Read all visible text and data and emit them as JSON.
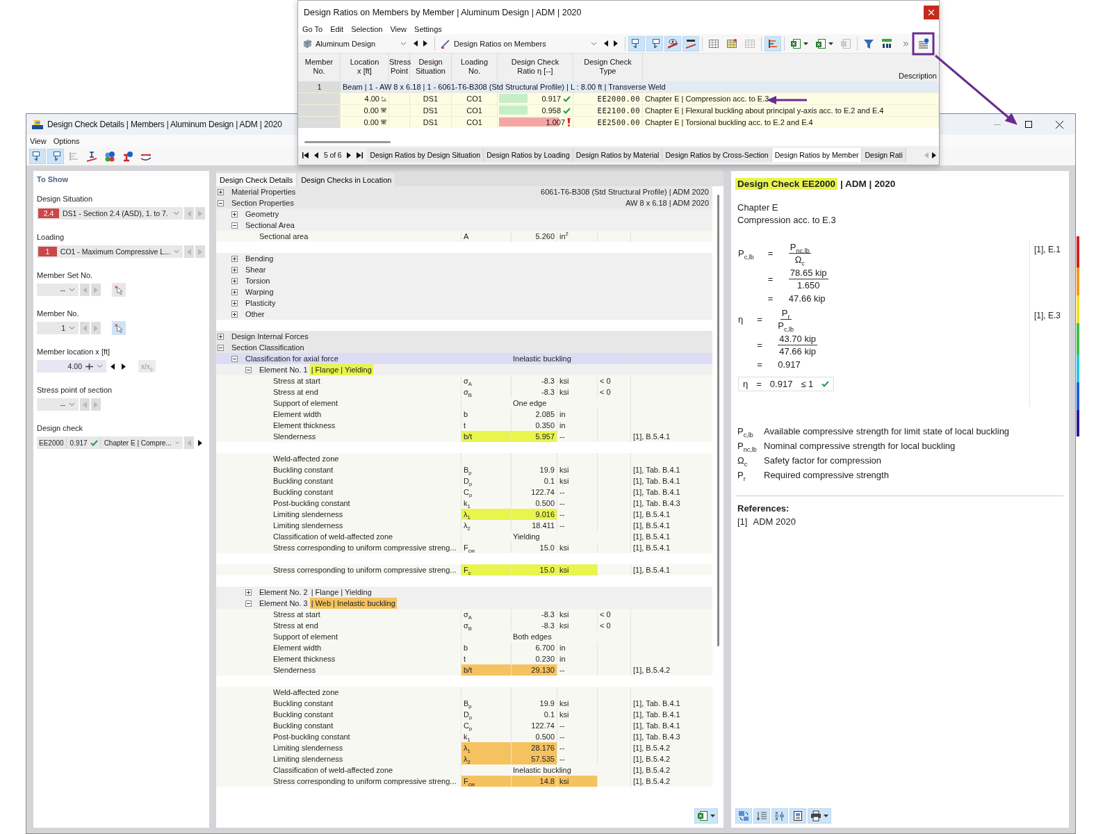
{
  "ratios_window": {
    "title": "Design Ratios on Members by Member | Aluminum Design | ADM | 2020",
    "menu": [
      "Go To",
      "Edit",
      "Selection",
      "View",
      "Settings"
    ],
    "module": "Aluminum Design",
    "result_type": "Design Ratios on Members",
    "tool_groups": [
      [
        {
          "kind": "select-next",
          "on": true
        },
        {
          "kind": "select-prev",
          "on": true
        },
        {
          "kind": "visibility",
          "on": true
        },
        {
          "kind": "decimals",
          "on": true
        }
      ],
      [
        {
          "kind": "table",
          "on": false
        },
        {
          "kind": "table-highlight",
          "on": false
        },
        {
          "kind": "table-disabled",
          "on": false
        }
      ],
      [
        {
          "kind": "bars",
          "on": true
        }
      ],
      [
        {
          "kind": "excel-export",
          "on": false,
          "dropdown": true
        },
        {
          "kind": "excel-import",
          "on": false,
          "dropdown": true
        },
        {
          "kind": "export-disabled",
          "on": false
        }
      ],
      [
        {
          "kind": "filter",
          "on": false
        },
        {
          "kind": "decimals-format",
          "on": false
        }
      ]
    ],
    "info_tool": {
      "kind": "info-list",
      "on": false
    },
    "columns": [
      "Member\nNo.",
      "Location\nx [ft]",
      "Stress\nPoint",
      "Design\nSituation",
      "Loading\nNo.",
      "Design Check\nRatio η [--]",
      "Design Check\nType",
      "Description"
    ],
    "group": {
      "member": "1",
      "text": "Beam | 1 - AW 8 x 6.18 | 1 - 6061-T6-B308 (Std Structural Profile) | L : 8.00 ft | Transverse Weld"
    },
    "rows": [
      {
        "location": "4.00",
        "midpoint": true,
        "situation": "DS1",
        "loading": "CO1",
        "ratio": "0.917",
        "ok": true,
        "type": "EE2000.00",
        "description": "Chapter E | Compression acc. to E.3"
      },
      {
        "location": "0.00",
        "midpoint": false,
        "situation": "DS1",
        "loading": "CO1",
        "ratio": "0.958",
        "ok": true,
        "type": "EE2100.00",
        "description": "Chapter E | Flexural buckling about principal y-axis acc. to E.2 and E.4"
      },
      {
        "location": "0.00",
        "midpoint": false,
        "situation": "DS1",
        "loading": "CO1",
        "ratio": "1.007",
        "ok": false,
        "type": "EE2500.00",
        "description": "Chapter E | Torsional buckling acc. to E.2 and E.4"
      }
    ],
    "pager": "5 of 6",
    "tabs": [
      {
        "label": "Design Ratios by Design Situation",
        "selected": false
      },
      {
        "label": "Design Ratios by Loading",
        "selected": false
      },
      {
        "label": "Design Ratios by Material",
        "selected": false
      },
      {
        "label": "Design Ratios by Cross-Section",
        "selected": false
      },
      {
        "label": "Design Ratios by Member",
        "selected": true
      },
      {
        "label": "Design Rati",
        "selected": false
      }
    ]
  },
  "details_window": {
    "title": "Design Check Details | Members | Aluminum Design | ADM | 2020",
    "menu": [
      "View",
      "Options"
    ],
    "tool_groups": [
      [
        {
          "kind": "select-next",
          "on": true
        },
        {
          "kind": "select-prev",
          "on": true
        },
        {
          "kind": "bars-disabled",
          "on": false
        },
        {
          "kind": "member-section",
          "on": false
        },
        {
          "kind": "color-info",
          "on": false
        },
        {
          "kind": "section-info",
          "on": false
        },
        {
          "kind": "deflection",
          "on": false
        }
      ]
    ],
    "filter": {
      "heading": "To Show",
      "fields": [
        {
          "kind": "combo",
          "label": "Design Situation",
          "badge": "2.4",
          "value": "DS1 - Section 2.4 (ASD), 1. to 7.",
          "prev_enabled": false,
          "next_enabled": false
        },
        {
          "kind": "combo",
          "label": "Loading",
          "badge": "1",
          "value": "CO1 - Maximum Compressive L...",
          "prev_enabled": false,
          "next_enabled": false
        },
        {
          "kind": "number",
          "label": "Member Set No.",
          "value": "--",
          "prev_enabled": false,
          "next_enabled": false,
          "pick_active": false
        },
        {
          "kind": "number",
          "label": "Member No.",
          "value": "1",
          "prev_enabled": false,
          "next_enabled": false,
          "pick_active": true
        },
        {
          "kind": "location",
          "label": "Member location x [ft]",
          "value": "4.00",
          "prev_enabled": true,
          "next_enabled": true,
          "extra": "x/x$_{0}$",
          "extra_disabled": true
        },
        {
          "kind": "number",
          "label": "Stress point of section",
          "value": "--",
          "prev_enabled": false,
          "next_enabled": false
        },
        {
          "kind": "check",
          "label": "Design check",
          "code": "EE2000",
          "ratio": "0.917",
          "ok": true,
          "value": "Chapter E | Compre...",
          "prev_enabled": false,
          "next_enabled": true
        }
      ]
    },
    "tabs": [
      {
        "label": "Design Check Details",
        "selected": true
      },
      {
        "label": "Design Checks in Location",
        "selected": false
      }
    ],
    "tree": [
      {
        "label": "Material Properties",
        "info": "6061-T6-B308 (Std Structural Profile) | ADM 2020",
        "expanded": false,
        "selected": false
      },
      {
        "label": "Section Properties",
        "info": "AW 8 x 6.18 | ADM 2020",
        "expanded": true,
        "selected": false,
        "children": [
          {
            "label": "Geometry",
            "expanded": false,
            "selected": false
          },
          {
            "label": "Sectional Area",
            "expanded": true,
            "selected": false,
            "children": [
              {
                "label": "Sectional area",
                "symbol": "A",
                "value": "5.260",
                "unit": "in$^{2}$",
                "selected": false,
                "gap_after": true
              }
            ]
          },
          {
            "label": "Bending",
            "expanded": false,
            "selected": false
          },
          {
            "label": "Shear",
            "expanded": false,
            "selected": false
          },
          {
            "label": "Torsion",
            "expanded": false,
            "selected": false
          },
          {
            "label": "Warping",
            "expanded": false,
            "selected": false
          },
          {
            "label": "Plasticity",
            "expanded": false,
            "selected": false
          },
          {
            "label": "Other",
            "expanded": false,
            "selected": false,
            "gap_after": true
          }
        ]
      },
      {
        "label": "Design Internal Forces",
        "expanded": false,
        "selected": false
      },
      {
        "label": "Section Classification",
        "expanded": true,
        "selected": false,
        "children": [
          {
            "label": "Classification for axial force",
            "note": "Inelastic buckling",
            "expanded": true,
            "selected": true,
            "children": [
              {
                "label": "Element No. 1",
                "tag": "| Flange | Yielding",
                "color": "#e8f54c",
                "expanded": true,
                "selected": false,
                "children": [
                  {
                    "label": "Stress at start",
                    "symbol": "σ$_{A}$",
                    "value": "-8.3",
                    "unit": "ksi",
                    "condition": "< 0",
                    "selected": false
                  },
                  {
                    "label": "Stress at end",
                    "symbol": "σ$_{B}$",
                    "value": "-8.3",
                    "unit": "ksi",
                    "condition": "< 0",
                    "selected": false
                  },
                  {
                    "label": "Support of element",
                    "note": "One edge",
                    "selected": false
                  },
                  {
                    "label": "Element width",
                    "symbol": "b",
                    "value": "2.085",
                    "unit": "in",
                    "selected": false
                  },
                  {
                    "label": "Element thickness",
                    "symbol": "t",
                    "value": "0.350",
                    "unit": "in",
                    "selected": false
                  },
                  {
                    "label": "Slenderness",
                    "symbol": "b/t",
                    "value": "5.957",
                    "unit": "--",
                    "ref": "[1], B.5.4.1",
                    "color": "#e8f54c",
                    "selected": false,
                    "gap_after": true
                  },
                  {
                    "label": "Weld-affected zone",
                    "selected": false
                  },
                  {
                    "label": "Buckling constant",
                    "symbol": "B$_{p}$",
                    "value": "19.9",
                    "unit": "ksi",
                    "ref": "[1], Tab. B.4.1",
                    "selected": false
                  },
                  {
                    "label": "Buckling constant",
                    "symbol": "D$_{p}$",
                    "value": "0.1",
                    "unit": "ksi",
                    "ref": "[1], Tab. B.4.1",
                    "selected": false
                  },
                  {
                    "label": "Buckling constant",
                    "symbol": "C$_{p}$",
                    "value": "122.74",
                    "unit": "--",
                    "ref": "[1], Tab. B.4.1",
                    "selected": false
                  },
                  {
                    "label": "Post-buckling constant",
                    "symbol": "k$_{1}$",
                    "value": "0.500",
                    "unit": "--",
                    "ref": "[1], Tab. B.4.3",
                    "selected": false
                  },
                  {
                    "label": "Limiting slenderness",
                    "symbol": "λ$_{1}$",
                    "value": "9.016",
                    "unit": "--",
                    "ref": "[1], B.5.4.1",
                    "color": "#e8f54c",
                    "selected": false
                  },
                  {
                    "label": "Limiting slenderness",
                    "symbol": "λ$_{2}$",
                    "value": "18.411",
                    "unit": "--",
                    "ref": "[1], B.5.4.1",
                    "selected": false
                  },
                  {
                    "label": "Classification of weld-affected zone",
                    "note": "Yielding",
                    "ref": "[1], B.5.4.1",
                    "selected": false
                  },
                  {
                    "label": "Stress corresponding to uniform compressive streng...",
                    "symbol": "F$_{cw}$",
                    "value": "15.0",
                    "unit": "ksi",
                    "ref": "[1], B.5.4.1",
                    "selected": false,
                    "gap_after": true
                  },
                  {
                    "label": "Stress corresponding to uniform compressive streng...",
                    "symbol": "F$_{c}$",
                    "value": "15.0",
                    "unit": "ksi",
                    "ref": "[1], B.5.4.1",
                    "color": "#e8f54c",
                    "highlight_unit": true,
                    "selected": false,
                    "gap_after": true
                  }
                ]
              },
              {
                "label": "Element No. 2",
                "tag": "| Flange | Yielding",
                "expanded": false,
                "selected": false
              },
              {
                "label": "Element No. 3",
                "tag": "| Web | Inelastic buckling",
                "color": "#f5c260",
                "expanded": true,
                "selected": false,
                "children": [
                  {
                    "label": "Stress at start",
                    "symbol": "σ$_{A}$",
                    "value": "-8.3",
                    "unit": "ksi",
                    "condition": "< 0",
                    "selected": false
                  },
                  {
                    "label": "Stress at end",
                    "symbol": "σ$_{B}$",
                    "value": "-8.3",
                    "unit": "ksi",
                    "condition": "< 0",
                    "selected": false
                  },
                  {
                    "label": "Support of element",
                    "note": "Both edges",
                    "selected": false
                  },
                  {
                    "label": "Element width",
                    "symbol": "b",
                    "value": "6.700",
                    "unit": "in",
                    "selected": false
                  },
                  {
                    "label": "Element thickness",
                    "symbol": "t",
                    "value": "0.230",
                    "unit": "in",
                    "selected": false
                  },
                  {
                    "label": "Slenderness",
                    "symbol": "b/t",
                    "value": "29.130",
                    "unit": "--",
                    "ref": "[1], B.5.4.2",
                    "color": "#f5c260",
                    "selected": false,
                    "gap_after": true
                  },
                  {
                    "label": "Weld-affected zone",
                    "selected": false
                  },
                  {
                    "label": "Buckling constant",
                    "symbol": "B$_{p}$",
                    "value": "19.9",
                    "unit": "ksi",
                    "ref": "[1], Tab. B.4.1",
                    "selected": false
                  },
                  {
                    "label": "Buckling constant",
                    "symbol": "D$_{p}$",
                    "value": "0.1",
                    "unit": "ksi",
                    "ref": "[1], Tab. B.4.1",
                    "selected": false
                  },
                  {
                    "label": "Buckling constant",
                    "symbol": "C$_{p}$",
                    "value": "122.74",
                    "unit": "--",
                    "ref": "[1], Tab. B.4.1",
                    "selected": false
                  },
                  {
                    "label": "Post-buckling constant",
                    "symbol": "k$_{1}$",
                    "value": "0.500",
                    "unit": "--",
                    "ref": "[1], Tab. B.4.3",
                    "selected": false
                  },
                  {
                    "label": "Limiting slenderness",
                    "symbol": "λ$_{1}$",
                    "value": "28.176",
                    "unit": "--",
                    "ref": "[1], B.5.4.2",
                    "color": "#f5c260",
                    "selected": false
                  },
                  {
                    "label": "Limiting slenderness",
                    "symbol": "λ$_{2}$",
                    "value": "57.535",
                    "unit": "--",
                    "ref": "[1], B.5.4.2",
                    "color": "#f5c260",
                    "selected": false
                  },
                  {
                    "label": "Classification of weld-affected zone",
                    "note": "Inelastic buckling",
                    "ref": "[1], B.5.4.2",
                    "selected": false
                  },
                  {
                    "label": "Stress corresponding to uniform compressive streng...",
                    "symbol": "F$_{cw}$",
                    "value": "14.8",
                    "unit": "ksi",
                    "ref": "[1], B.5.4.2",
                    "color": "#f5c260",
                    "highlight_unit": true,
                    "selected": false
                  }
                ]
              }
            ]
          }
        ]
      }
    ],
    "tree_tools": [
      [
        {
          "kind": "excel-export",
          "on": true,
          "dropdown": true
        }
      ]
    ],
    "calc": {
      "heading": "Design Check EE2000",
      "heading_rest": "| ADM | 2020",
      "lines": [
        "Chapter E",
        "Compression acc. to E.3"
      ],
      "equations": [
        {
          "lhs": "P$_{c,lb}$",
          "ref": "[1], E.1",
          "steps": [
            {
              "relation": "=",
              "kind": "fraction",
              "num": "P$_{nc,lb}$",
              "den": "Ω$_{c}$"
            },
            {
              "relation": "=",
              "kind": "fraction",
              "num": "78.65 kip",
              "den": "1.650"
            },
            {
              "relation": "=",
              "kind": "value",
              "text": "47.66 kip"
            }
          ]
        },
        {
          "lhs": "η",
          "ref": "[1], E.3",
          "steps": [
            {
              "relation": "=",
              "kind": "fraction",
              "num": "P$_{r}$",
              "den": "P$_{c,lb}$"
            },
            {
              "relation": "=",
              "kind": "fraction",
              "num": "43.70 kip",
              "den": "47.66 kip"
            },
            {
              "relation": "=",
              "kind": "value",
              "text": "0.917"
            }
          ]
        }
      ],
      "result": {
        "lhs": "η",
        "relation": "=",
        "value": "0.917",
        "condition": "≤ 1",
        "ok": true
      },
      "legend": [
        {
          "symbol": "P$_{c,lb}$",
          "text": "Available compressive strength for limit state of local buckling"
        },
        {
          "symbol": "P$_{nc,lb}$",
          "text": "Nominal compressive strength for local buckling"
        },
        {
          "symbol": "Ω$_{c}$",
          "text": "Safety factor for compression"
        },
        {
          "symbol": "P$_{r}$",
          "text": "Required compressive strength"
        }
      ],
      "references_heading": "References:",
      "references": [
        {
          "tag": "[1]",
          "text": "ADM 2020"
        }
      ]
    },
    "calc_tools": [
      [
        {
          "kind": "swap-picture",
          "on": true
        },
        {
          "kind": "list-order",
          "on": true
        },
        {
          "kind": "formula",
          "on": true
        },
        {
          "kind": "report-preview",
          "on": true
        },
        {
          "kind": "print",
          "on": true,
          "dropdown": true
        }
      ]
    ]
  }
}
